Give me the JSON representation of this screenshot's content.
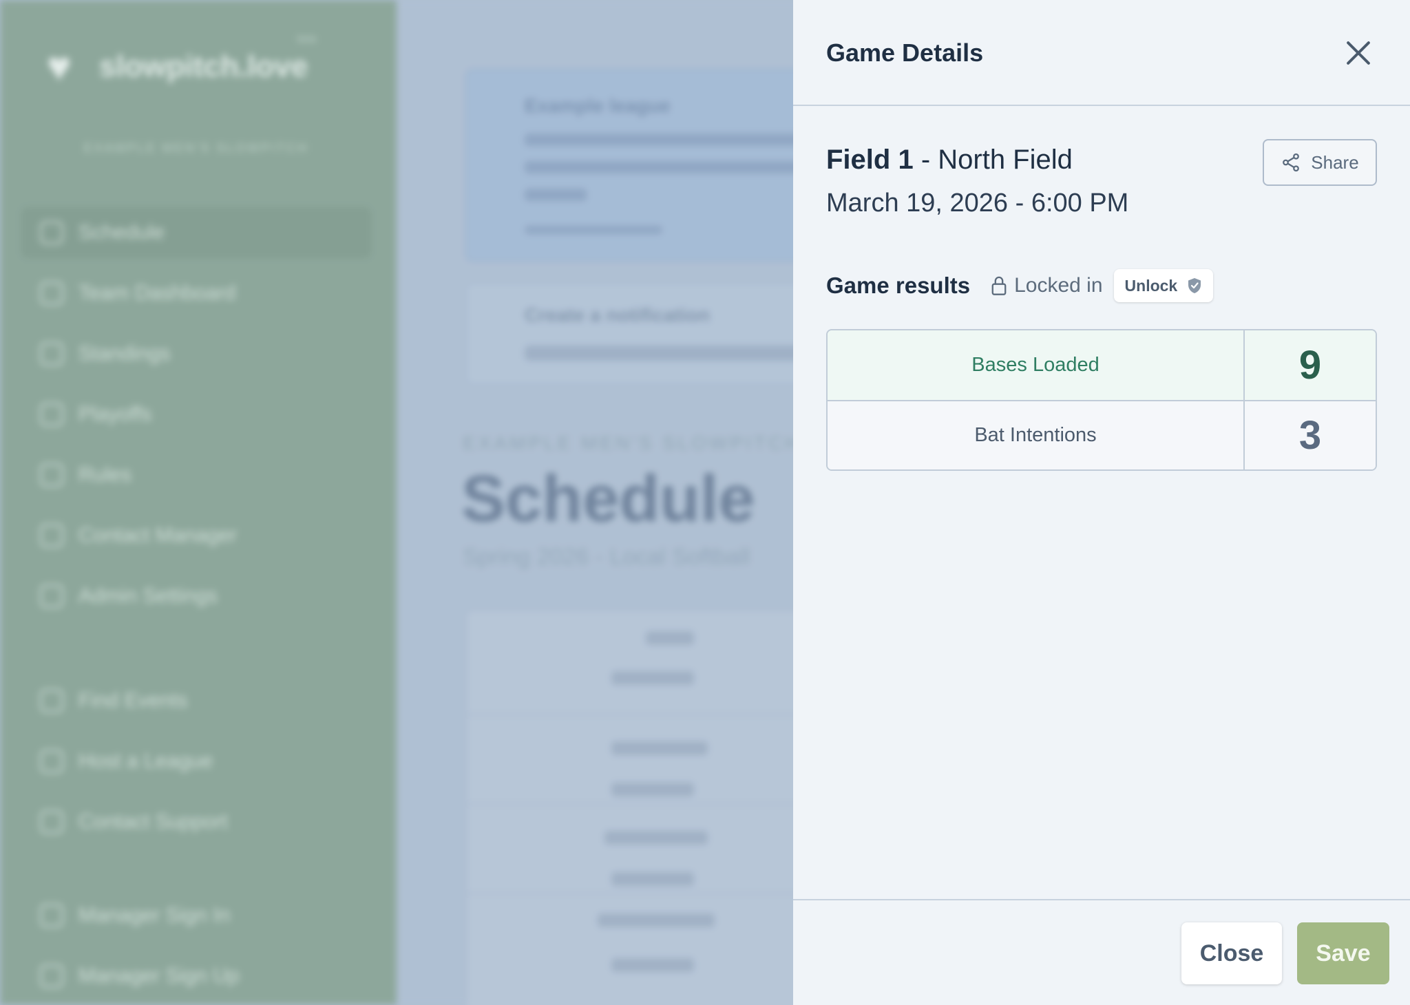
{
  "background": {
    "logo_text": "slowpitch.love",
    "logo_tag": "beta",
    "league_subtitle": "EXAMPLE MEN'S SLOWPITCH",
    "nav": [
      {
        "label": "Schedule",
        "active": true
      },
      {
        "label": "Team Dashboard"
      },
      {
        "label": "Standings"
      },
      {
        "label": "Playoffs"
      },
      {
        "label": "Rules"
      },
      {
        "label": "Contact Manager"
      },
      {
        "label": "Admin Settings"
      }
    ],
    "nav_lower": [
      {
        "label": "Find Events"
      },
      {
        "label": "Host a League"
      },
      {
        "label": "Contact Support"
      }
    ],
    "nav_bottom": [
      {
        "label": "Manager Sign In"
      },
      {
        "label": "Manager Sign Up"
      }
    ],
    "alert_title": "Example league",
    "notif_title": "Create a notification",
    "eyebrow": "EXAMPLE MEN'S SLOWPITCH",
    "page_title": "Schedule",
    "season": "Spring 2026 - Local Softball"
  },
  "drawer": {
    "title": "Game Details",
    "field_name": "Field 1",
    "location_separator": " - ",
    "field_location": "North Field",
    "datetime": "March 19, 2026 - 6:00 PM",
    "share_label": "Share",
    "results_label": "Game results",
    "locked_label": "Locked in",
    "unlock_label": "Unlock",
    "results": [
      {
        "team": "Bases Loaded",
        "score": "9",
        "winner": true
      },
      {
        "team": "Bat Intentions",
        "score": "3",
        "winner": false
      }
    ],
    "close_label": "Close",
    "save_label": "Save"
  },
  "colors": {
    "save_accent": "#a3b985",
    "winner_text": "#2f7e62",
    "sidebar_bg": "#8fa99a"
  }
}
